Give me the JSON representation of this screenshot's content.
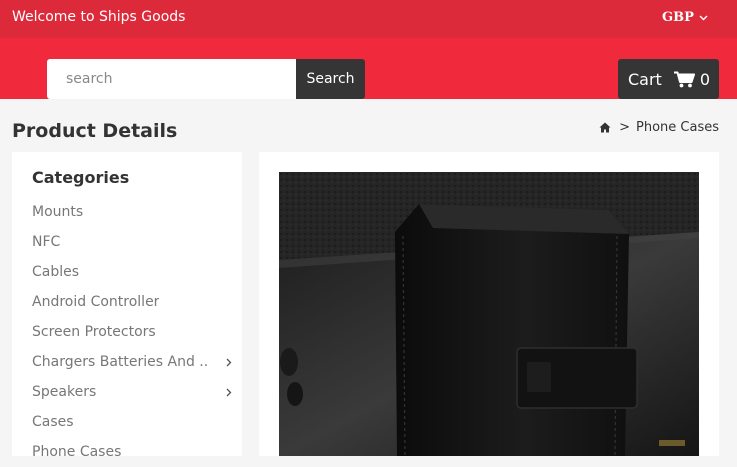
{
  "topbar": {
    "welcome": "Welcome to Ships Goods",
    "currency": "GBP"
  },
  "search": {
    "placeholder": "search",
    "button_label": "Search"
  },
  "cart": {
    "label": "Cart",
    "count": "0"
  },
  "page": {
    "title": "Product Details"
  },
  "breadcrumb": {
    "current": "Phone Cases",
    "separator": ">"
  },
  "sidebar": {
    "title": "Categories",
    "items": [
      {
        "label": "Mounts",
        "has_children": false
      },
      {
        "label": "NFC",
        "has_children": false
      },
      {
        "label": "Cables",
        "has_children": false
      },
      {
        "label": "Android Controller",
        "has_children": false
      },
      {
        "label": "Screen Protectors",
        "has_children": false
      },
      {
        "label": "Chargers Batteries And ..",
        "has_children": true
      },
      {
        "label": "Speakers",
        "has_children": true
      },
      {
        "label": "Cases",
        "has_children": false
      },
      {
        "label": "Phone Cases",
        "has_children": false
      }
    ]
  },
  "colors": {
    "topbar": "#dc2a3b",
    "header": "#f0293d",
    "dark_button": "#353535"
  },
  "icons": {
    "cart": "cart-icon",
    "home": "home-icon",
    "chevron": "chevron-right-icon",
    "currency_dropdown": "chevron-down-icon"
  }
}
